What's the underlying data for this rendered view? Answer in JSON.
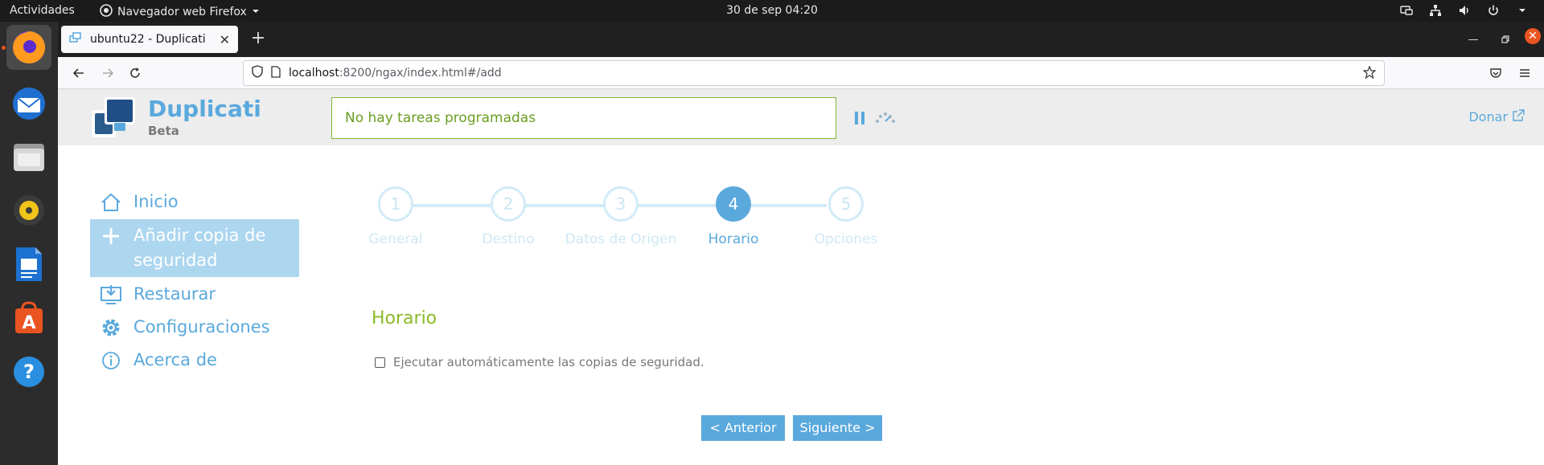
{
  "system": {
    "activities": "Actividades",
    "app_menu": "Navegador web Firefox",
    "clock": "30 de sep  04:20"
  },
  "browser": {
    "tab_title": "ubuntu22 - Duplicati",
    "url_host": "localhost",
    "url_rest": ":8200/ngax/index.html#/add"
  },
  "header": {
    "logo_title": "Duplicati",
    "logo_sub": "Beta",
    "status": "No hay tareas programadas",
    "donate": "Donar"
  },
  "sidebar": {
    "items": [
      {
        "label": "Inicio",
        "icon": "home-icon"
      },
      {
        "label": "Añadir copia de seguridad",
        "icon": "plus-icon"
      },
      {
        "label": "Restaurar",
        "icon": "restore-icon"
      },
      {
        "label": "Configuraciones",
        "icon": "gear-icon"
      },
      {
        "label": "Acerca de",
        "icon": "info-icon"
      }
    ],
    "active_index": 1
  },
  "wizard": {
    "steps": [
      {
        "number": "1",
        "label": "General"
      },
      {
        "number": "2",
        "label": "Destino"
      },
      {
        "number": "3",
        "label": "Datos de Origen"
      },
      {
        "number": "4",
        "label": "Horario"
      },
      {
        "number": "5",
        "label": "Opciones"
      }
    ],
    "current_step": 4,
    "section_title": "Horario",
    "auto_run_label": "Ejecutar automáticamente las copias de seguridad.",
    "auto_run_checked": false,
    "prev_label": "< Anterior",
    "next_label": "Siguiente >"
  },
  "colors": {
    "accent": "#5aa9dd",
    "active_nav_bg": "#add6ef",
    "green": "#8cba28",
    "ubuntu_orange": "#e95420"
  }
}
